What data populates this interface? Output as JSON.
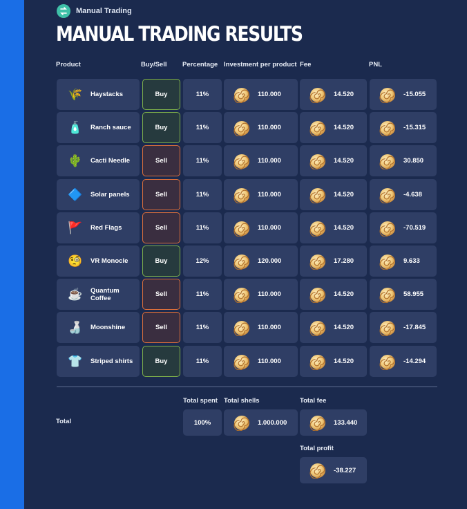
{
  "app": {
    "name": "Manual Trading",
    "title": "MANUAL TRADING RESULTS"
  },
  "columns": {
    "product": "Product",
    "side": "Buy/Sell",
    "percentage": "Percentage",
    "investment": "Investment per product",
    "fee": "Fee",
    "pnl": "PNL"
  },
  "rows": [
    {
      "icon": "haystack-icon",
      "glyph": "🌾",
      "product": "Haystacks",
      "side": "Buy",
      "percentage": "11%",
      "investment": "110.000",
      "fee": "14.520",
      "pnl": "-15.055"
    },
    {
      "icon": "ranch-sauce-icon",
      "glyph": "🧴",
      "product": "Ranch sauce",
      "side": "Buy",
      "percentage": "11%",
      "investment": "110.000",
      "fee": "14.520",
      "pnl": "-15.315"
    },
    {
      "icon": "cacti-needle-icon",
      "glyph": "🌵",
      "product": "Cacti Needle",
      "side": "Sell",
      "percentage": "11%",
      "investment": "110.000",
      "fee": "14.520",
      "pnl": "30.850"
    },
    {
      "icon": "solar-panels-icon",
      "glyph": "🔷",
      "product": "Solar panels",
      "side": "Sell",
      "percentage": "11%",
      "investment": "110.000",
      "fee": "14.520",
      "pnl": "-4.638"
    },
    {
      "icon": "red-flag-icon",
      "glyph": "🚩",
      "product": "Red Flags",
      "side": "Sell",
      "percentage": "11%",
      "investment": "110.000",
      "fee": "14.520",
      "pnl": "-70.519"
    },
    {
      "icon": "vr-monocle-icon",
      "glyph": "🧐",
      "product": "VR Monocle",
      "side": "Buy",
      "percentage": "12%",
      "investment": "120.000",
      "fee": "17.280",
      "pnl": "9.633"
    },
    {
      "icon": "quantum-coffee-icon",
      "glyph": "☕",
      "product": "Quantum Coffee",
      "side": "Sell",
      "percentage": "11%",
      "investment": "110.000",
      "fee": "14.520",
      "pnl": "58.955"
    },
    {
      "icon": "moonshine-icon",
      "glyph": "🍶",
      "product": "Moonshine",
      "side": "Sell",
      "percentage": "11%",
      "investment": "110.000",
      "fee": "14.520",
      "pnl": "-17.845"
    },
    {
      "icon": "striped-shirt-icon",
      "glyph": "👕",
      "product": "Striped shirts",
      "side": "Buy",
      "percentage": "11%",
      "investment": "110.000",
      "fee": "14.520",
      "pnl": "-14.294"
    }
  ],
  "totals": {
    "label": "Total",
    "spent_label": "Total spent",
    "spent_value": "100%",
    "shells_label": "Total shells",
    "shells_value": "1.000.000",
    "fee_label": "Total fee",
    "fee_value": "133.440",
    "profit_label": "Total profit",
    "profit_value": "-38.227"
  },
  "colors": {
    "background": "#1b2a4e",
    "cell": "#2f3e65",
    "buy_border": "#7fb24a",
    "sell_border": "#e0703a",
    "sidebar": "#1a6ee6"
  }
}
